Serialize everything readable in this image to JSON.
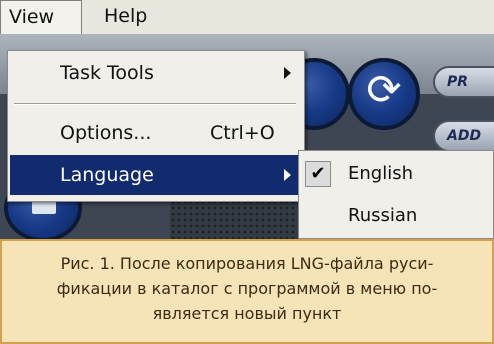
{
  "menubar": {
    "view": "View",
    "help": "Help"
  },
  "view_menu": {
    "task_tools": "Task Tools",
    "options": "Options...",
    "options_shortcut": "Ctrl+O",
    "language": "Language"
  },
  "language_menu": {
    "english": "English",
    "russian": "Russian",
    "check_glyph": "✔",
    "selected": "English"
  },
  "background_app": {
    "button_1_label": "PR",
    "button_2_label": "ADD",
    "refresh_glyph": "⟳"
  },
  "caption": {
    "line1": "Рис. 1. После копирования LNG-файла руси-",
    "line2": "фикации в каталог с программой в меню по-",
    "line3": "является новый пункт"
  },
  "colors": {
    "menu_highlight": "#112b6e",
    "caption_background": "#f7e3b8",
    "caption_border": "#d4a24a",
    "app_background": "#3e4553"
  }
}
